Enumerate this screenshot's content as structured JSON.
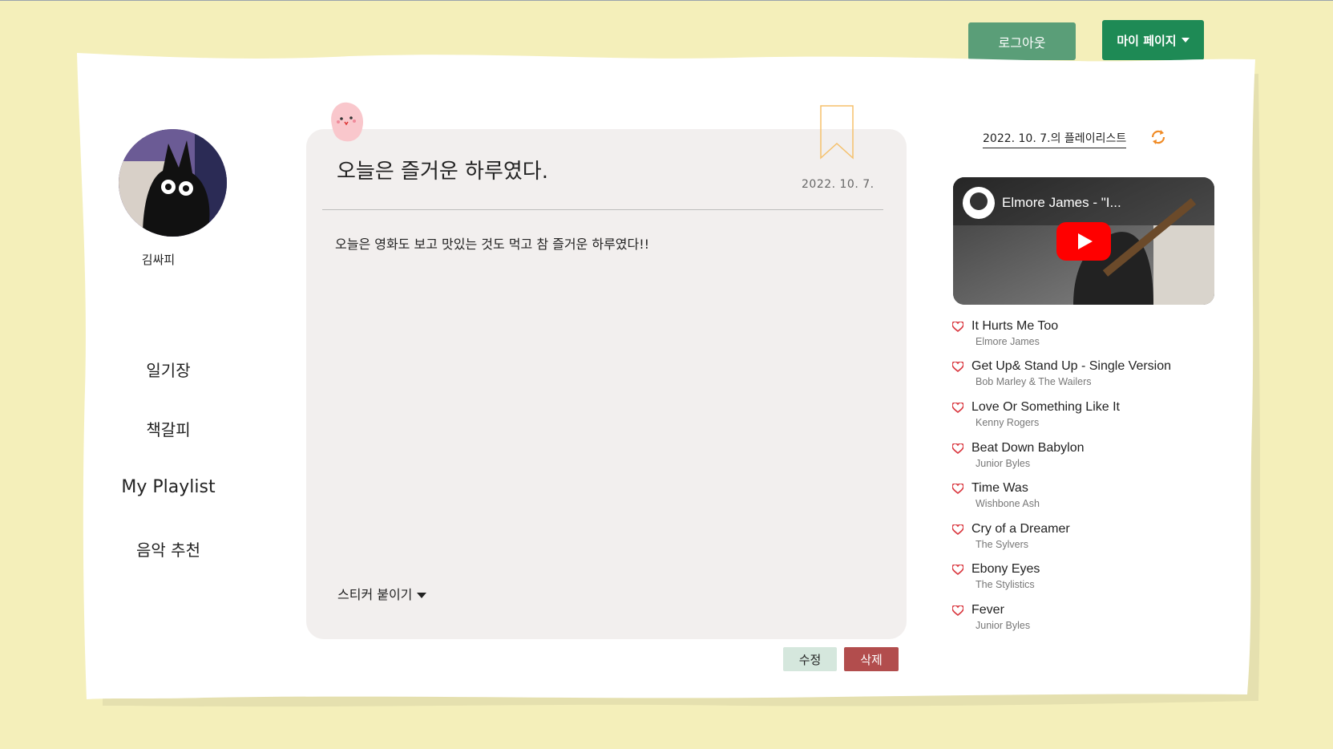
{
  "header": {
    "logout_label": "로그아웃",
    "mypage_label": "마이 페이지"
  },
  "profile": {
    "username": "김싸피"
  },
  "nav": {
    "items": [
      {
        "label": "일기장"
      },
      {
        "label": "책갈피"
      },
      {
        "label": "My Playlist"
      },
      {
        "label": "음악 추천"
      }
    ]
  },
  "diary": {
    "title": "오늘은 즐거운 하루였다.",
    "date": "2022. 10. 7.",
    "body": "오늘은 영화도 보고 맛있는 것도 먹고 참 즐거운 하루였다!!",
    "sticker_label": "스티커 붙이기",
    "edit_label": "수정",
    "delete_label": "삭제"
  },
  "playlist": {
    "date_label": "2022. 10. 7.의 플레이리스트",
    "video_title": "Elmore James - \"I...",
    "tracks": [
      {
        "title": "It Hurts Me Too",
        "artist": "Elmore James"
      },
      {
        "title": "Get Up& Stand Up - Single Version",
        "artist": "Bob Marley & The Wailers"
      },
      {
        "title": "Love Or Something Like It",
        "artist": "Kenny Rogers"
      },
      {
        "title": "Beat Down Babylon",
        "artist": "Junior Byles"
      },
      {
        "title": "Time Was",
        "artist": "Wishbone Ash"
      },
      {
        "title": "Cry of a Dreamer",
        "artist": "The Sylvers"
      },
      {
        "title": "Ebony Eyes",
        "artist": "The Stylistics"
      },
      {
        "title": "Fever",
        "artist": "Junior Byles"
      }
    ]
  },
  "colors": {
    "background": "#f4efba",
    "logout_button": "#5a9e78",
    "mypage_button": "#1e8a55",
    "card": "#f2efee",
    "edit_button": "#d5e7dd",
    "delete_button": "#b24d4d",
    "heart": "#d9363e",
    "refresh": "#f08a24",
    "bookmark": "#f5c06b"
  },
  "icons": [
    "heart-icon",
    "refresh-icon",
    "bookmark-icon",
    "youtube-play-icon",
    "ghost-sticker-icon",
    "chevron-down-icon"
  ]
}
